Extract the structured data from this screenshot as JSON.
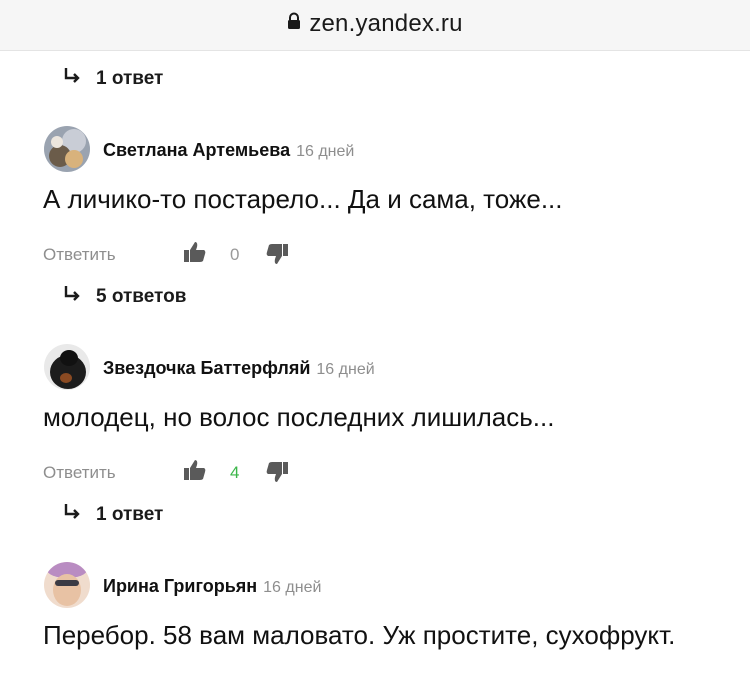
{
  "browser": {
    "url": "zen.yandex.ru"
  },
  "thread_top": {
    "replies_label": "1 ответ"
  },
  "comments": [
    {
      "author": "Светлана Артемьева",
      "time": "16 дней",
      "text": "А личико-то постарело... Да и сама, тоже...",
      "reply_label": "Ответить",
      "likes": "0",
      "replies_label": "5 ответов"
    },
    {
      "author": "Звездочка Баттерфляй",
      "time": "16 дней",
      "text": "молодец, но волос последних лишилась...",
      "reply_label": "Ответить",
      "likes": "4",
      "replies_label": "1 ответ"
    },
    {
      "author": "Ирина Григорьян",
      "time": "16 дней",
      "text": "Перебор. 58 вам маловато. Уж простите, сухофрукт."
    }
  ],
  "colors": {
    "positive": "#3cb64a",
    "muted": "#8e8e8e",
    "icon": "#5a5a5a"
  }
}
